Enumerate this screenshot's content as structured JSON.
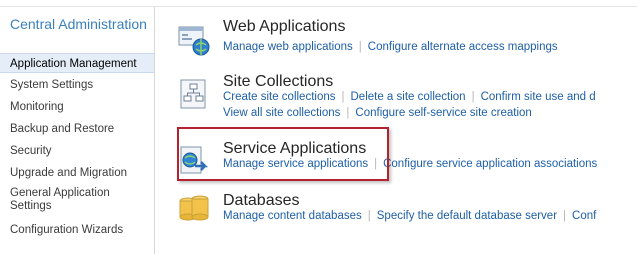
{
  "sidebar": {
    "title": "Central Administration",
    "items": [
      {
        "label": "Application Management",
        "selected": true
      },
      {
        "label": "System Settings"
      },
      {
        "label": "Monitoring"
      },
      {
        "label": "Backup and Restore"
      },
      {
        "label": "Security"
      },
      {
        "label": "Upgrade and Migration"
      },
      {
        "label": "General Application Settings"
      },
      {
        "label": "Configuration Wizards"
      }
    ]
  },
  "sections": [
    {
      "title": "Web Applications",
      "icon": "web-applications-icon",
      "links": [
        [
          "Manage web applications",
          "Configure alternate access mappings"
        ]
      ]
    },
    {
      "title": "Site Collections",
      "icon": "site-collections-icon",
      "links": [
        [
          "Create site collections",
          "Delete a site collection",
          "Confirm site use and d"
        ],
        [
          "View all site collections",
          "Configure self-service site creation"
        ]
      ]
    },
    {
      "title": "Service Applications",
      "icon": "service-applications-icon",
      "highlighted": true,
      "links": [
        [
          "Manage service applications",
          "Configure service application associations"
        ]
      ]
    },
    {
      "title": "Databases",
      "icon": "databases-icon",
      "links": [
        [
          "Manage content databases",
          "Specify the default database server",
          "Conf"
        ]
      ]
    }
  ],
  "colors": {
    "link": "#1e5fa6",
    "nav_title": "#3a80bd",
    "highlight_border": "#b42230"
  }
}
